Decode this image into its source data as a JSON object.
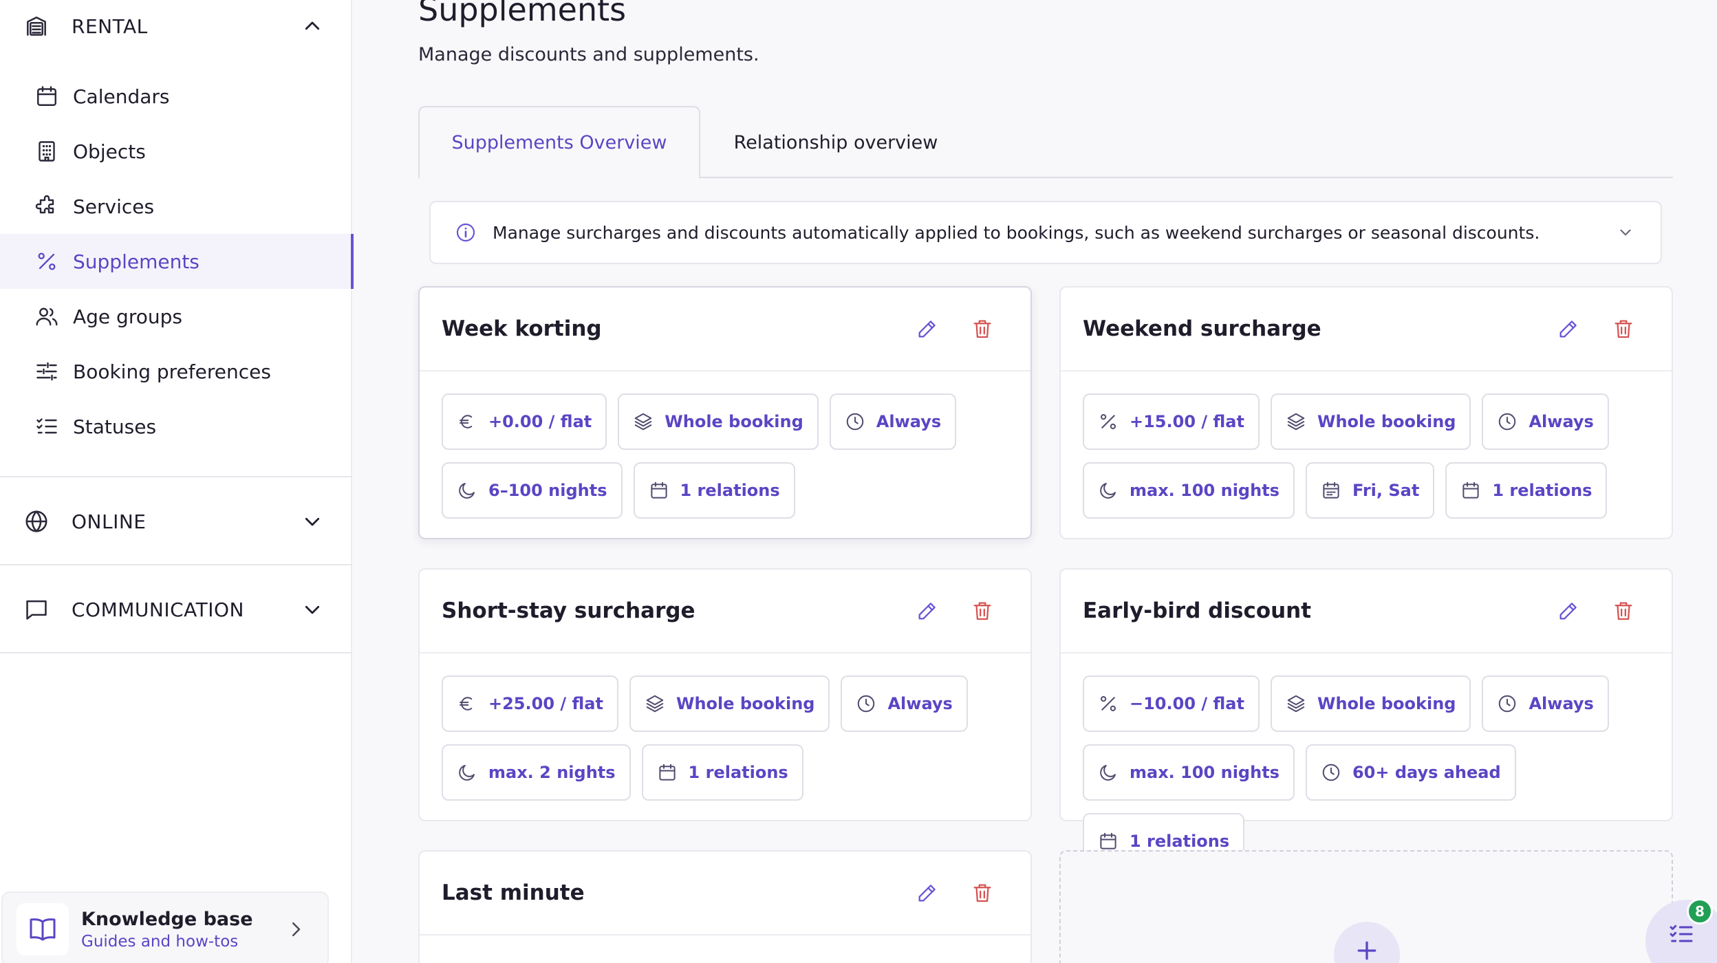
{
  "sidebar": {
    "sections": {
      "rental": {
        "label": "RENTAL",
        "icon": "building-icon",
        "expanded": true
      },
      "online": {
        "label": "ONLINE",
        "icon": "globe-icon",
        "expanded": false
      },
      "communication": {
        "label": "COMMUNICATION",
        "icon": "message-icon",
        "expanded": false
      }
    },
    "items": [
      {
        "label": "Calendars",
        "icon": "calendar-icon"
      },
      {
        "label": "Objects",
        "icon": "building-grid-icon"
      },
      {
        "label": "Services",
        "icon": "puzzle-icon"
      },
      {
        "label": "Supplements",
        "icon": "percent-icon",
        "active": true
      },
      {
        "label": "Age groups",
        "icon": "users-icon"
      },
      {
        "label": "Booking preferences",
        "icon": "sliders-icon"
      },
      {
        "label": "Statuses",
        "icon": "checklist-icon"
      }
    ],
    "knowledge_base": {
      "title": "Knowledge base",
      "subtitle": "Guides and how-tos"
    }
  },
  "page": {
    "title": "Supplements",
    "subtitle": "Manage discounts and supplements."
  },
  "tabs": [
    {
      "label": "Supplements Overview",
      "active": true
    },
    {
      "label": "Relationship overview",
      "active": false
    }
  ],
  "info": {
    "text": "Manage surcharges and discounts automatically applied to bookings, such as weekend surcharges or seasonal discounts."
  },
  "cards": [
    {
      "title": "Week korting",
      "chips": [
        {
          "icon": "euro-icon",
          "label": "+0.00 / flat"
        },
        {
          "icon": "layers-icon",
          "label": "Whole booking"
        },
        {
          "icon": "clock-icon",
          "label": "Always"
        },
        {
          "icon": "moon-icon",
          "label": "6–100 nights"
        },
        {
          "icon": "calendar-icon",
          "label": "1 relations"
        }
      ]
    },
    {
      "title": "Weekend surcharge",
      "chips": [
        {
          "icon": "percent-icon",
          "label": "+15.00 / flat"
        },
        {
          "icon": "layers-icon",
          "label": "Whole booking"
        },
        {
          "icon": "clock-icon",
          "label": "Always"
        },
        {
          "icon": "moon-icon",
          "label": "max. 100 nights"
        },
        {
          "icon": "calendar-days-icon",
          "label": "Fri, Sat"
        },
        {
          "icon": "calendar-icon",
          "label": "1 relations"
        }
      ]
    },
    {
      "title": "Short-stay surcharge",
      "chips": [
        {
          "icon": "euro-icon",
          "label": "+25.00 / flat"
        },
        {
          "icon": "layers-icon",
          "label": "Whole booking"
        },
        {
          "icon": "clock-icon",
          "label": "Always"
        },
        {
          "icon": "moon-icon",
          "label": "max. 2 nights"
        },
        {
          "icon": "calendar-icon",
          "label": "1 relations"
        }
      ]
    },
    {
      "title": "Early-bird discount",
      "chips": [
        {
          "icon": "percent-icon",
          "label": "−10.00 / flat"
        },
        {
          "icon": "layers-icon",
          "label": "Whole booking"
        },
        {
          "icon": "clock-icon",
          "label": "Always"
        },
        {
          "icon": "moon-icon",
          "label": "max. 100 nights"
        },
        {
          "icon": "clock-icon",
          "label": "60+ days ahead"
        },
        {
          "icon": "calendar-icon",
          "label": "1 relations"
        }
      ]
    },
    {
      "title": "Last minute",
      "chips": []
    }
  ],
  "fab": {
    "badge": "8",
    "icon": "checklist-icon"
  },
  "colors": {
    "accent": "#6a52d6",
    "accent_text": "#5b45c4",
    "danger": "#d65252",
    "badge": "#21a055"
  }
}
